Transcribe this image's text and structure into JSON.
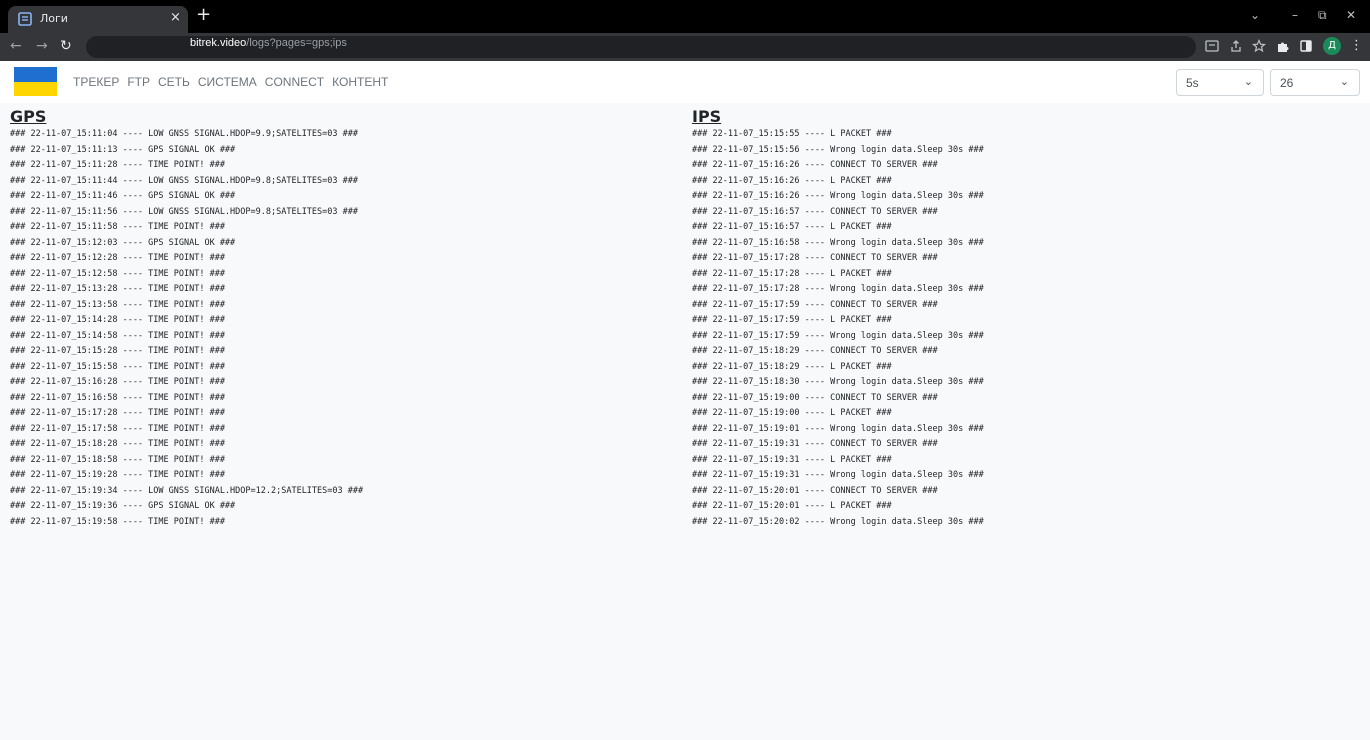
{
  "browser": {
    "tab_title": "Логи",
    "tab_close": "×",
    "new_tab": "+",
    "url_host": "bitrek.video",
    "url_path": "/logs?pages=gps;ips",
    "avatar_letter": "Д",
    "win_controls": [
      "⌄",
      "–",
      "⧉",
      "✕"
    ]
  },
  "navbar": {
    "flag": {
      "top_color": "#1f6fd1",
      "bottom_color": "#ffd500"
    },
    "menu": [
      "ТРЕКЕР",
      "FTP",
      "СЕТЬ",
      "СИСТЕМА",
      "CONNECT",
      "КОНТЕНТ"
    ],
    "interval_select": "5s",
    "count_select": "26"
  },
  "gps": {
    "title": "GPS",
    "lines": [
      "### 22-11-07_15:11:04 ---- LOW GNSS SIGNAL.HDOP=9.9;SATELITES=03 ###",
      "### 22-11-07_15:11:13 ---- GPS SIGNAL OK ###",
      "### 22-11-07_15:11:28 ---- TIME POINT! ###",
      "### 22-11-07_15:11:44 ---- LOW GNSS SIGNAL.HDOP=9.8;SATELITES=03 ###",
      "### 22-11-07_15:11:46 ---- GPS SIGNAL OK ###",
      "### 22-11-07_15:11:56 ---- LOW GNSS SIGNAL.HDOP=9.8;SATELITES=03 ###",
      "### 22-11-07_15:11:58 ---- TIME POINT! ###",
      "### 22-11-07_15:12:03 ---- GPS SIGNAL OK ###",
      "### 22-11-07_15:12:28 ---- TIME POINT! ###",
      "### 22-11-07_15:12:58 ---- TIME POINT! ###",
      "### 22-11-07_15:13:28 ---- TIME POINT! ###",
      "### 22-11-07_15:13:58 ---- TIME POINT! ###",
      "### 22-11-07_15:14:28 ---- TIME POINT! ###",
      "### 22-11-07_15:14:58 ---- TIME POINT! ###",
      "### 22-11-07_15:15:28 ---- TIME POINT! ###",
      "### 22-11-07_15:15:58 ---- TIME POINT! ###",
      "### 22-11-07_15:16:28 ---- TIME POINT! ###",
      "### 22-11-07_15:16:58 ---- TIME POINT! ###",
      "### 22-11-07_15:17:28 ---- TIME POINT! ###",
      "### 22-11-07_15:17:58 ---- TIME POINT! ###",
      "### 22-11-07_15:18:28 ---- TIME POINT! ###",
      "### 22-11-07_15:18:58 ---- TIME POINT! ###",
      "### 22-11-07_15:19:28 ---- TIME POINT! ###",
      "### 22-11-07_15:19:34 ---- LOW GNSS SIGNAL.HDOP=12.2;SATELITES=03 ###",
      "### 22-11-07_15:19:36 ---- GPS SIGNAL OK ###",
      "### 22-11-07_15:19:58 ---- TIME POINT! ###"
    ]
  },
  "ips": {
    "title": "IPS",
    "lines": [
      "### 22-11-07_15:15:55 ---- L PACKET ###",
      "### 22-11-07_15:15:56 ---- Wrong login data.Sleep 30s ###",
      "### 22-11-07_15:16:26 ---- CONNECT TO SERVER ###",
      "### 22-11-07_15:16:26 ---- L PACKET ###",
      "### 22-11-07_15:16:26 ---- Wrong login data.Sleep 30s ###",
      "### 22-11-07_15:16:57 ---- CONNECT TO SERVER ###",
      "### 22-11-07_15:16:57 ---- L PACKET ###",
      "### 22-11-07_15:16:58 ---- Wrong login data.Sleep 30s ###",
      "### 22-11-07_15:17:28 ---- CONNECT TO SERVER ###",
      "### 22-11-07_15:17:28 ---- L PACKET ###",
      "### 22-11-07_15:17:28 ---- Wrong login data.Sleep 30s ###",
      "### 22-11-07_15:17:59 ---- CONNECT TO SERVER ###",
      "### 22-11-07_15:17:59 ---- L PACKET ###",
      "### 22-11-07_15:17:59 ---- Wrong login data.Sleep 30s ###",
      "### 22-11-07_15:18:29 ---- CONNECT TO SERVER ###",
      "### 22-11-07_15:18:29 ---- L PACKET ###",
      "### 22-11-07_15:18:30 ---- Wrong login data.Sleep 30s ###",
      "### 22-11-07_15:19:00 ---- CONNECT TO SERVER ###",
      "### 22-11-07_15:19:00 ---- L PACKET ###",
      "### 22-11-07_15:19:01 ---- Wrong login data.Sleep 30s ###",
      "### 22-11-07_15:19:31 ---- CONNECT TO SERVER ###",
      "### 22-11-07_15:19:31 ---- L PACKET ###",
      "### 22-11-07_15:19:31 ---- Wrong login data.Sleep 30s ###",
      "### 22-11-07_15:20:01 ---- CONNECT TO SERVER ###",
      "### 22-11-07_15:20:01 ---- L PACKET ###",
      "### 22-11-07_15:20:02 ---- Wrong login data.Sleep 30s ###"
    ]
  }
}
